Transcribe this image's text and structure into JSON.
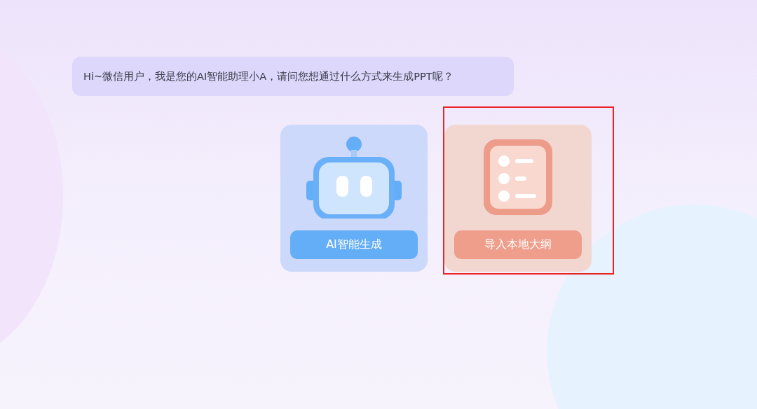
{
  "message": {
    "text": "Hi~微信用户，我是您的AI智能助理小A，请问您想通过什么方式来生成PPT呢？"
  },
  "options": [
    {
      "kind": "robot",
      "label": "AI智能生成",
      "highlighted": false
    },
    {
      "kind": "outline",
      "label": "导入本地大纲",
      "highlighted": true
    }
  ]
}
